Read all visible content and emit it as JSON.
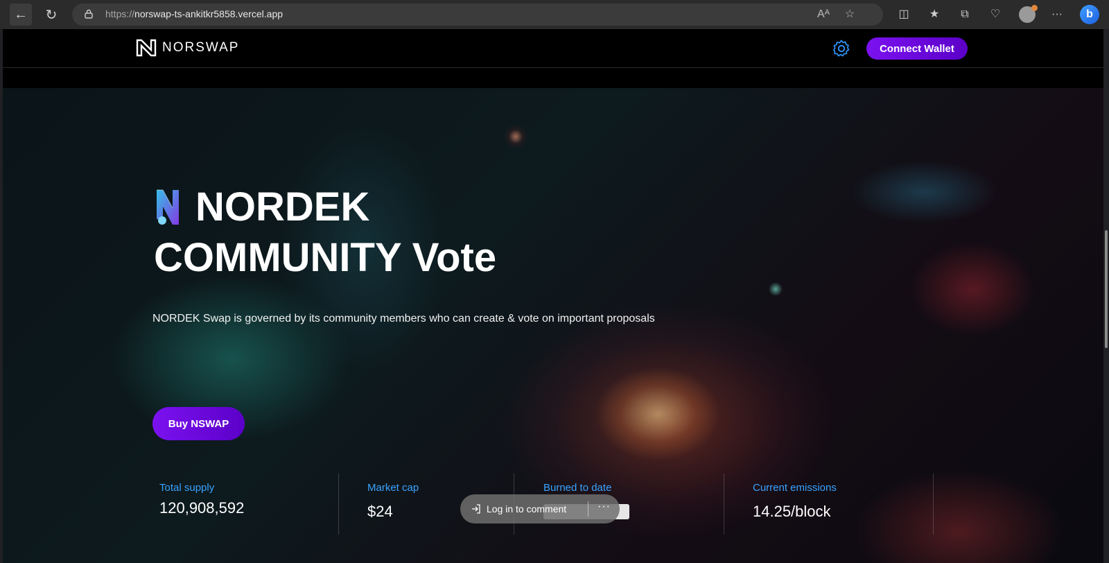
{
  "browser": {
    "url_protocol": "https://",
    "url_host": "norswap-ts-ankitkr5858.vercel.app",
    "read_aloud_glyph": "Aᴬ"
  },
  "header": {
    "logo_text": "NORSWAP",
    "connect_label": "Connect Wallet"
  },
  "hero": {
    "title_line1": "NORDEK",
    "title_line2": "COMMUNITY Vote",
    "subtitle": "NORDEK Swap is governed by its community members who can create & vote on important proposals",
    "buy_label": "Buy NSWAP"
  },
  "stats": [
    {
      "label": "Total supply",
      "value": "120,908,592"
    },
    {
      "label": "Market cap",
      "value": "$24"
    },
    {
      "label": "Burned to date",
      "value": ""
    },
    {
      "label": "Current emissions",
      "value": "14.25/block"
    }
  ],
  "comment": {
    "label": "Log in to comment",
    "more": "···"
  },
  "colors": {
    "accent_purple": "#7b12f0",
    "stat_label_blue": "#3aa3ff",
    "gear_blue": "#2f8ff0"
  }
}
